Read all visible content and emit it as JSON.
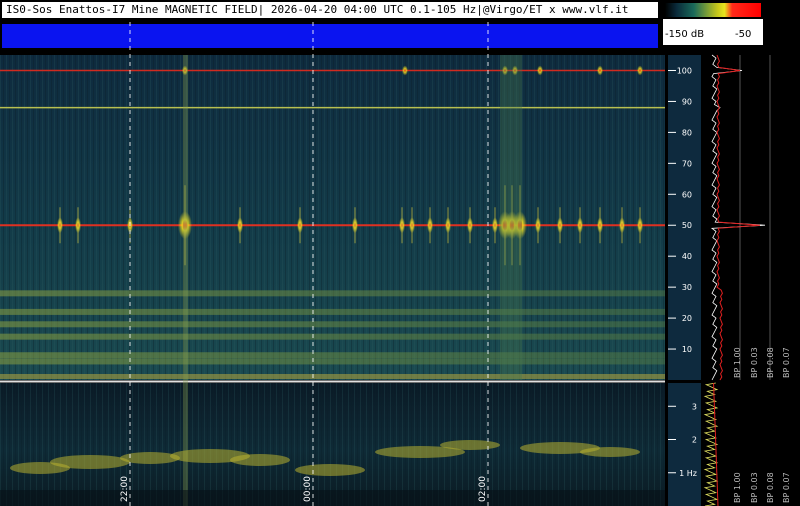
{
  "header": {
    "title": "IS0-Sos Enattos-I7 Mine MAGNETIC FIELD| 2026-04-20 04:00 UTC 0.1-105 Hz|@Virgo/ET x www.vlf.it"
  },
  "colorbar": {
    "min_label": "-150 dB",
    "max_label": "-50",
    "colors": [
      "#000000",
      "#1a6a5a",
      "#e6e61e",
      "#ff0000"
    ]
  },
  "chart_data": {
    "type": "heatmap",
    "title": "IS0-Sos Enattos-I7 Mine MAGNETIC FIELD| 2026-04-20 04:00 UTC 0.1-105 Hz|@Virgo/ET x www.vlf.it",
    "x_ticks": [
      "22:00",
      "00:00",
      "02:00"
    ],
    "upper_panel": {
      "y_ticks": [
        "10",
        "20",
        "30",
        "40",
        "50",
        "60",
        "70",
        "80",
        "90",
        "100"
      ],
      "y_range": [
        0,
        105
      ],
      "features": [
        {
          "kind": "horizontal_line",
          "freq": 100,
          "color": "#d02a20"
        },
        {
          "kind": "horizontal_line",
          "freq": 88,
          "color": "#b8c050"
        },
        {
          "kind": "horizontal_line",
          "freq": 50,
          "color": "#e03020"
        },
        {
          "kind": "horizontal_bands",
          "freqs": [
            6,
            8,
            14,
            18,
            22,
            28
          ]
        }
      ],
      "side_labels": [
        "BP 1.00",
        "BP 0.03",
        "BP 0.08",
        "BP 0.07"
      ]
    },
    "lower_panel": {
      "y_ticks": [
        "1 Hz",
        "2",
        "3"
      ],
      "y_range": [
        0,
        3.7
      ],
      "side_labels": [
        "BP 1.00",
        "BP 0.03",
        "BP 0.08",
        "BP 0.07"
      ]
    },
    "colorscale_db": [
      -150,
      -50
    ]
  }
}
